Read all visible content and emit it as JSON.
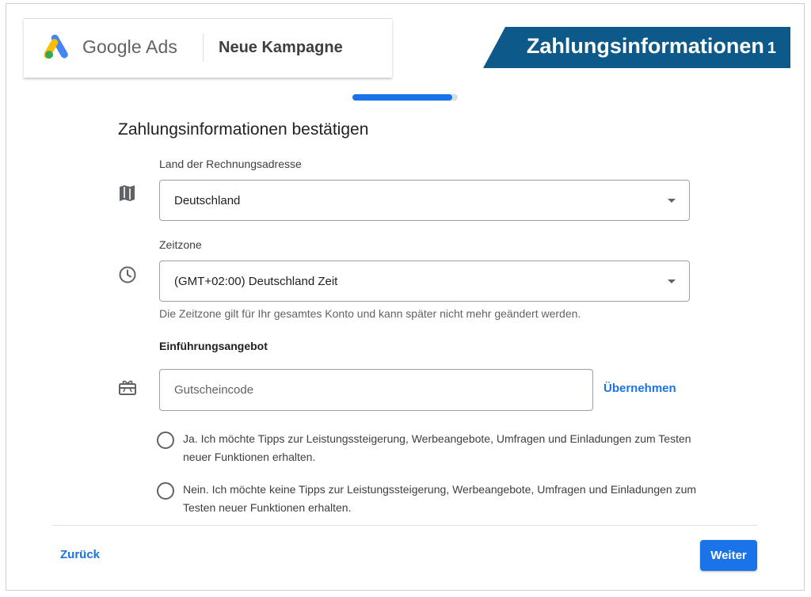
{
  "header": {
    "brand_google": "Google",
    "brand_ads": "Ads",
    "campaign_title": "Neue Kampagne"
  },
  "banner": {
    "text": "Zahlungsinformationen",
    "number": "1",
    "color": "#0d5a8a"
  },
  "progress": {
    "value": 0.95
  },
  "page_title": "Zahlungsinformationen bestätigen",
  "billing_country": {
    "label": "Land der Rechnungsadresse",
    "value": "Deutschland",
    "icon": "map-icon"
  },
  "timezone": {
    "label": "Zeitzone",
    "value": "(GMT+02:00) Deutschland Zeit",
    "hint": "Die Zeitzone gilt für Ihr gesamtes Konto und kann später nicht mehr geändert werden.",
    "icon": "clock-icon"
  },
  "intro_offer": {
    "label": "Einführungsangebot",
    "placeholder": "Gutscheincode",
    "apply_label": "Übernehmen",
    "icon": "gift-icon"
  },
  "options": [
    {
      "text": "Ja. Ich möchte Tipps zur Leistungssteigerung, Werbeangebote, Umfragen und Einladungen zum Testen neuer Funktionen erhalten."
    },
    {
      "text": "Nein. Ich möchte keine Tipps zur Leistungssteigerung, Werbeangebote, Umfragen und Einladungen zum Testen neuer Funktionen erhalten."
    }
  ],
  "footer": {
    "back_label": "Zurück",
    "next_label": "Weiter"
  },
  "colors": {
    "accent": "#1a73e8",
    "ads_yellow": "#fbbc04",
    "ads_blue": "#4285f4",
    "ads_green": "#34a853"
  }
}
